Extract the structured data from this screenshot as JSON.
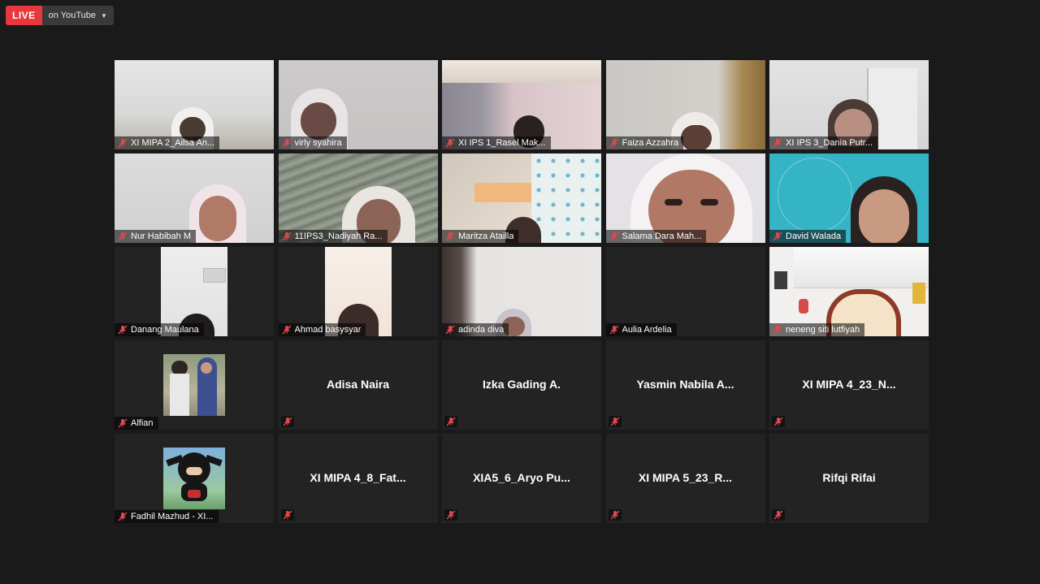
{
  "live": {
    "badge": "LIVE",
    "destination": "on YouTube"
  },
  "participants": [
    {
      "name": "XI MIPA 2_Ailsa An...",
      "mode": "video"
    },
    {
      "name": "virly syahira",
      "mode": "video"
    },
    {
      "name": "XI IPS 1_Rasel Mak...",
      "mode": "video"
    },
    {
      "name": "Faiza Azzahra",
      "mode": "video"
    },
    {
      "name": "XI IPS 3_Dania Putr...",
      "mode": "video"
    },
    {
      "name": "Nur Habibah M",
      "mode": "video"
    },
    {
      "name": "11IPS3_Nadiyah Ra...",
      "mode": "video"
    },
    {
      "name": "Maritza Atailla",
      "mode": "video"
    },
    {
      "name": "Salama Dara Mah...",
      "mode": "video"
    },
    {
      "name": "David Walada",
      "mode": "video"
    },
    {
      "name": "Danang Maulana",
      "mode": "video"
    },
    {
      "name": "Ahmad basysyar",
      "mode": "video"
    },
    {
      "name": "adinda diva",
      "mode": "video"
    },
    {
      "name": "Aulia Ardelia",
      "mode": "blank"
    },
    {
      "name": "neneng siti lutfiyah",
      "mode": "video"
    },
    {
      "name": "Alfian",
      "mode": "avatar"
    },
    {
      "name": "Adisa Naira",
      "mode": "name"
    },
    {
      "name": "Izka Gading A.",
      "mode": "name"
    },
    {
      "name": "Yasmin Nabila A...",
      "mode": "name"
    },
    {
      "name": "XI MIPA 4_23_N...",
      "mode": "name"
    },
    {
      "name": "Fadhil Mazhud - XI...",
      "mode": "avatar"
    },
    {
      "name": "XI MIPA 4_8_Fat...",
      "mode": "name"
    },
    {
      "name": "XIA5_6_Aryo Pu...",
      "mode": "name"
    },
    {
      "name": "XI MIPA 5_23_R...",
      "mode": "name"
    },
    {
      "name": "Rifqi Rifai",
      "mode": "name"
    }
  ],
  "icons": {
    "muted": "microphone-muted-icon",
    "dropdown": "chevron-down-icon"
  },
  "colors": {
    "live_red": "#e8383d",
    "background": "#1a1a1a",
    "tile_dark": "#232323",
    "mute_red": "#e0474c"
  }
}
